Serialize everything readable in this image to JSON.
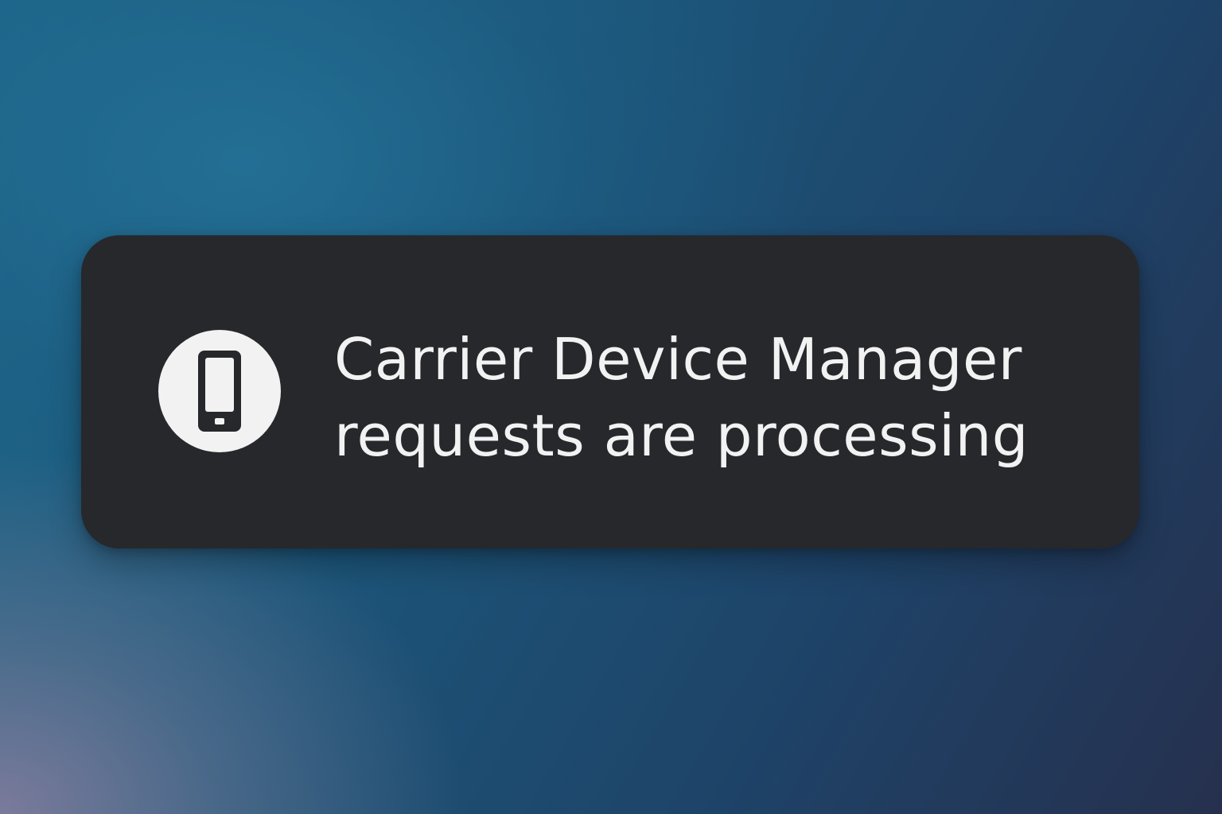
{
  "notification": {
    "icon": "smartphone-icon",
    "line1": "Carrier Device Manager",
    "line2": "requests are processing"
  },
  "colors": {
    "toast_background": "#27282c",
    "icon_circle": "#f2f2f2",
    "text": "#f2f2f2"
  }
}
